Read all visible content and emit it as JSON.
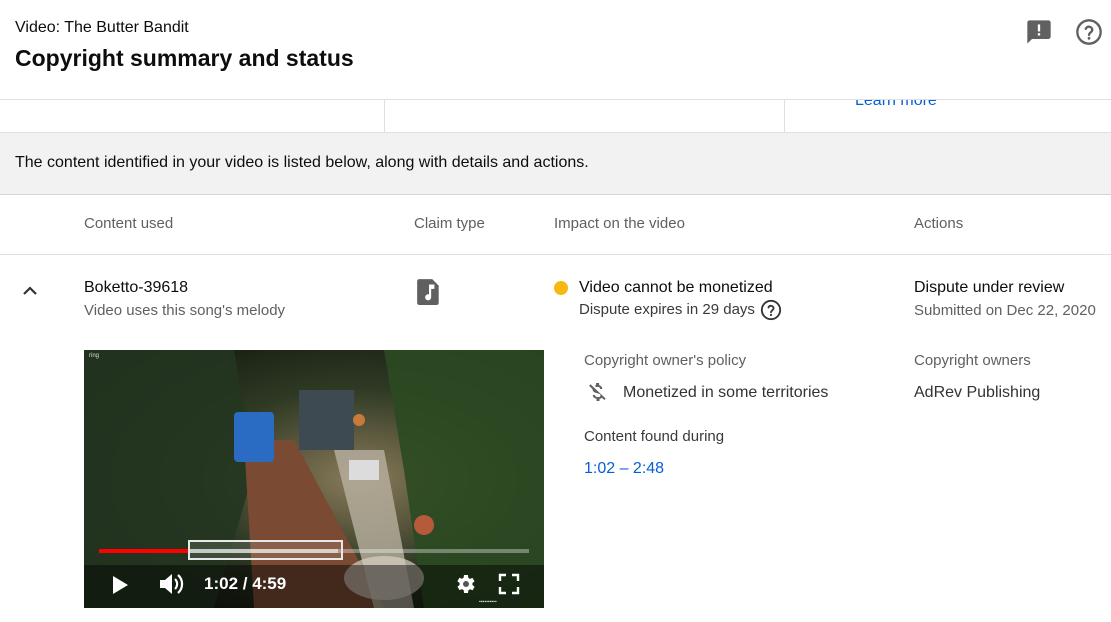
{
  "header": {
    "video_label": "Video: The Butter Bandit",
    "title": "Copyright summary and status",
    "feedback_icon": "feedback-icon",
    "help_icon": "help-circle-icon"
  },
  "summary_strip": {
    "learn_more": "Learn more"
  },
  "info": {
    "text": "The content identified in your video is listed below, along with details and actions."
  },
  "columns": {
    "content_used": "Content used",
    "claim_type": "Claim type",
    "impact": "Impact on the video",
    "actions": "Actions"
  },
  "claim": {
    "title": "Boketto-39618",
    "subtitle": "Video uses this song's melody",
    "claim_type_icon": "music-note-icon",
    "impact_status": "Video cannot be monetized",
    "impact_color": "#f9b811",
    "impact_detail": "Dispute expires in 29 days",
    "action_status": "Dispute under review",
    "action_detail": "Submitted on Dec 22, 2020",
    "policy_label": "Copyright owner's policy",
    "policy_value": "Monetized in some territories",
    "policy_icon": "money-off-icon",
    "owners_label": "Copyright owners",
    "owners_value": "AdRev Publishing",
    "found_label": "Content found during",
    "found_range": "1:02 – 2:48"
  },
  "player": {
    "watermark": "ring",
    "time": "1:02 / 4:59",
    "progress_fraction": 0.207,
    "segment_start_fraction": 0.207,
    "segment_end_fraction": 0.555
  },
  "colors": {
    "accent": "#065fd4",
    "progress": "#ff0000"
  }
}
